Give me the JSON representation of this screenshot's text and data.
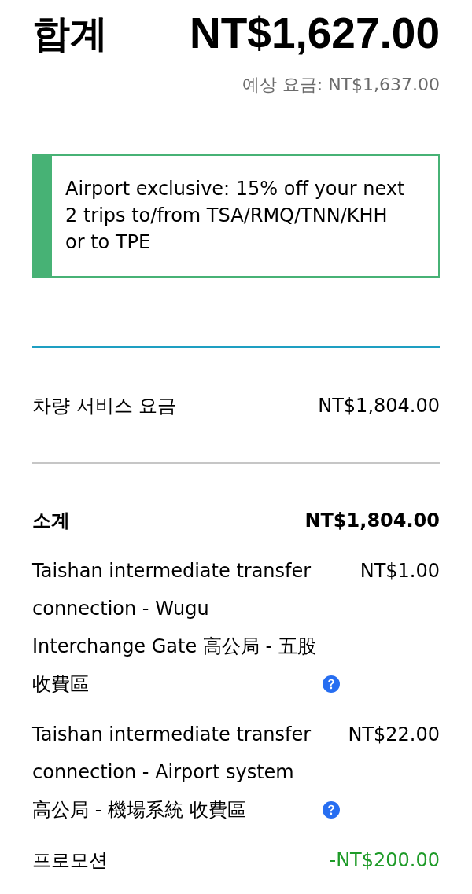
{
  "total": {
    "label": "합계",
    "amount": "NT$1,627.00"
  },
  "estimate": "예상 요금: NT$1,637.00",
  "promo_banner": {
    "text": "Airport exclusive: 15% off your next 2 trips to/from TSA/RMQ/TNN/KHH or to TPE"
  },
  "fare": {
    "label": "차량 서비스 요금",
    "amount": "NT$1,804.00"
  },
  "lines": [
    {
      "kind": "subtotal",
      "label": "소계",
      "amount": "NT$1,804.00"
    },
    {
      "kind": "toll",
      "label": "Taishan intermediate transfer connection - Wugu Interchange Gate 高公局 - 五股收費區",
      "amount": "NT$1.00"
    },
    {
      "kind": "toll",
      "label": "Taishan intermediate transfer connection - Airport system 高公局 - 機場系統 收費區",
      "amount": "NT$22.00"
    },
    {
      "kind": "discount",
      "label": "프로모션",
      "amount": "-NT$200.00"
    }
  ]
}
